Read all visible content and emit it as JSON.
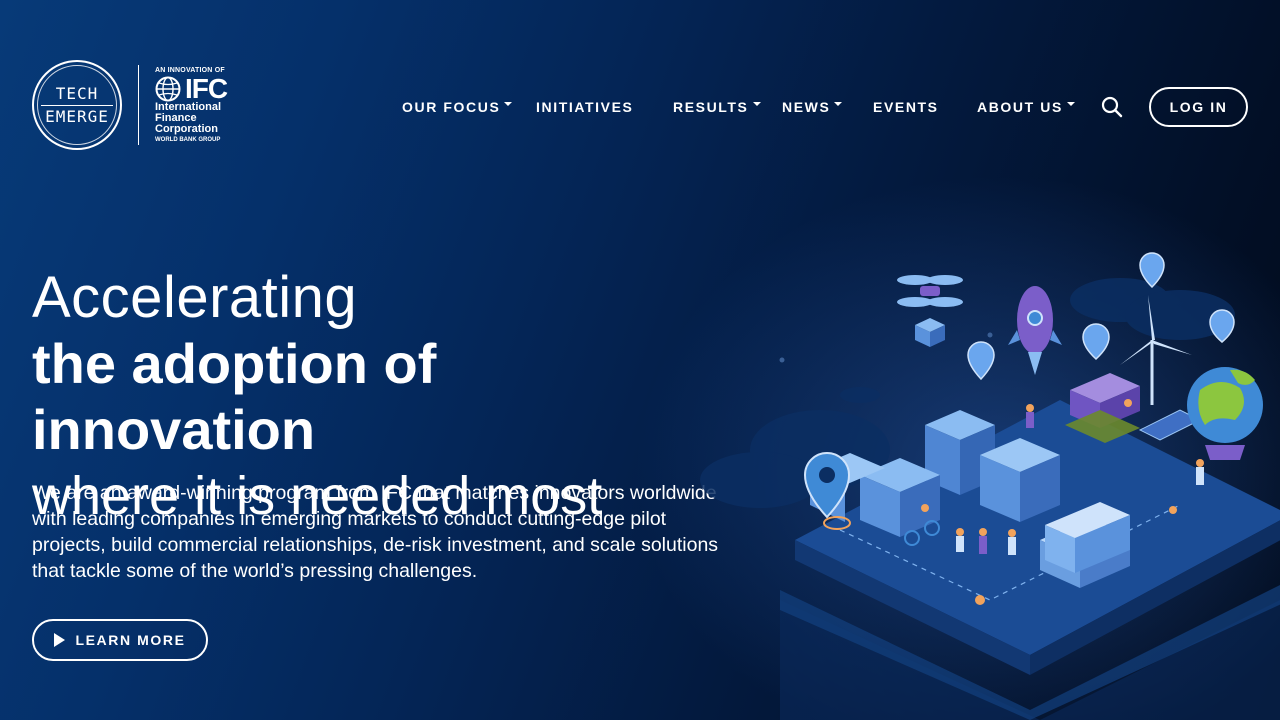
{
  "logo": {
    "tech_line1": "TECH",
    "tech_line2": "EMERGE",
    "ifc_tagline": "AN INNOVATION OF",
    "ifc_letters": "IFC",
    "ifc_name_1": "International",
    "ifc_name_2": "Finance",
    "ifc_name_3": "Corporation",
    "ifc_group": "WORLD BANK GROUP"
  },
  "nav": {
    "items": [
      {
        "label": "OUR FOCUS",
        "dropdown": true
      },
      {
        "label": "INITIATIVES",
        "dropdown": false
      },
      {
        "label": "RESULTS",
        "dropdown": true
      },
      {
        "label": "NEWS",
        "dropdown": true
      },
      {
        "label": "EVENTS",
        "dropdown": false
      },
      {
        "label": "ABOUT US",
        "dropdown": true
      }
    ],
    "search_icon": "search-icon",
    "login_label": "LOG IN"
  },
  "hero": {
    "line1": "Accelerating",
    "line2": "the adoption of innovation",
    "line3": "where it is needed most",
    "description": "We are an award-winning program from IFC that matches innovators worldwide with leading companies in emerging markets to conduct cutting-edge pilot projects, build commercial relationships, de-risk investment, and scale solutions that tackle some of the world’s pressing challenges.",
    "cta_label": "LEARN MORE",
    "cta_icon": "play-icon"
  },
  "colors": {
    "background_dark": "#020f26",
    "background_blue": "#073a78",
    "text": "#ffffff",
    "accent_green": "#8cc63f",
    "accent_purple": "#7b5ec9"
  }
}
